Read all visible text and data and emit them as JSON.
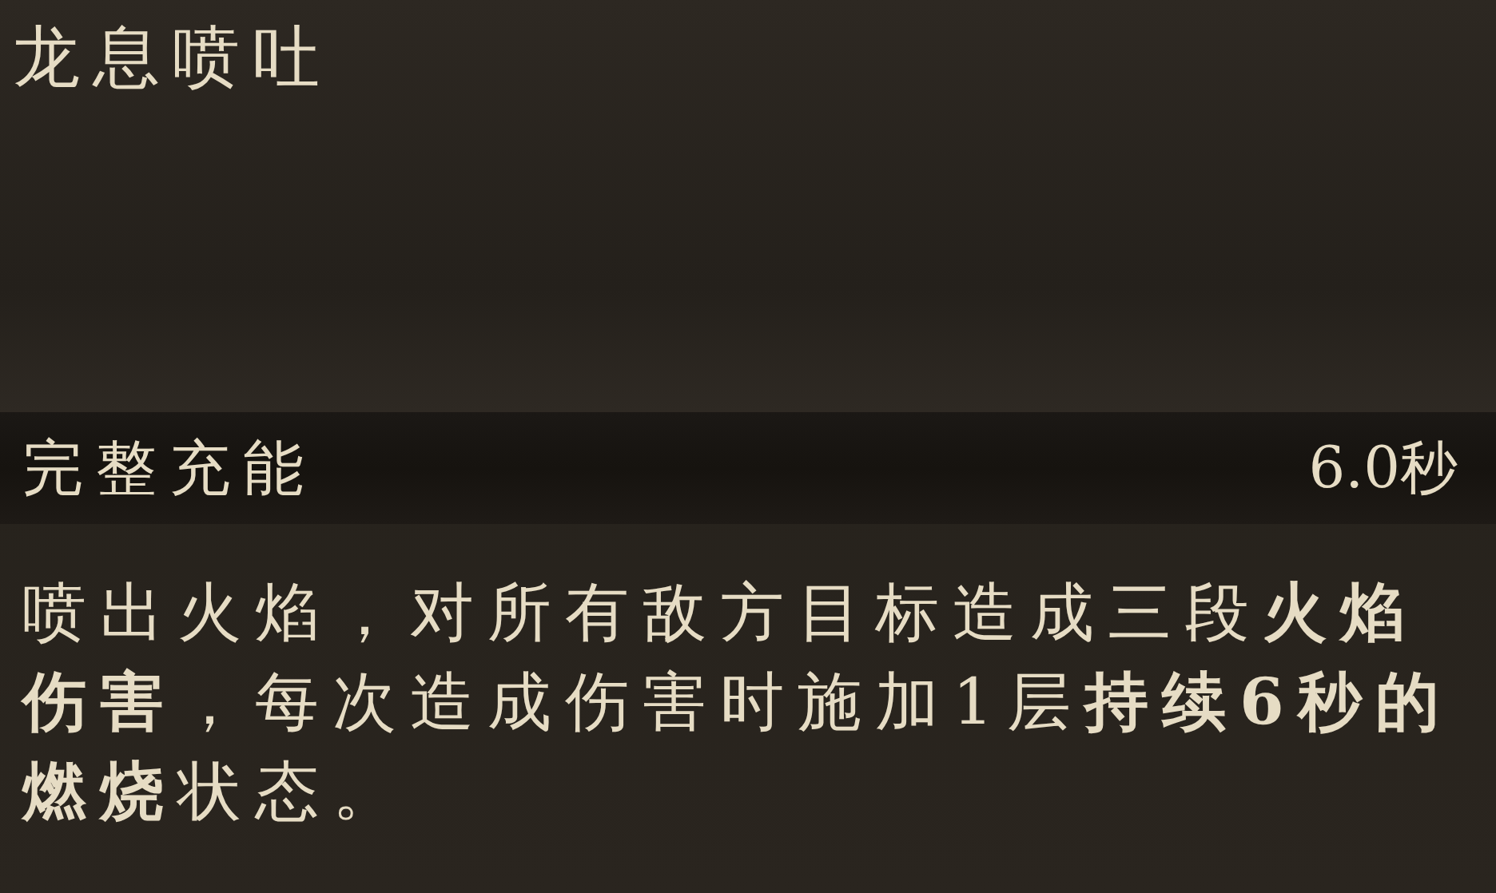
{
  "title": "龙息喷吐",
  "charge": {
    "label": "完整充能",
    "value": "6.0秒"
  },
  "description": "喷出火焰，对所有敌方目标造成三段**火焰伤害**，每次造成伤害时施加1层**持续6秒的燃烧**状态。"
}
